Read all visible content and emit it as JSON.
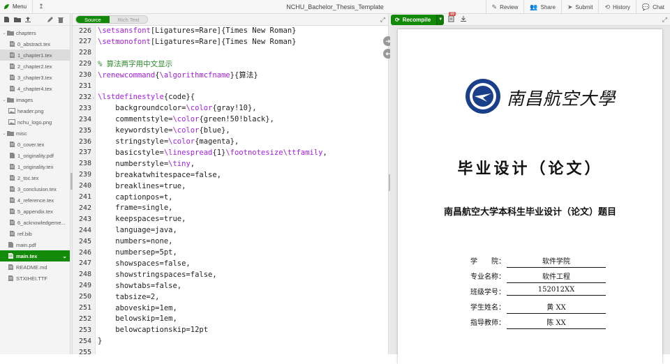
{
  "topbar": {
    "menu_label": "Menu",
    "project_title": "NCHU_Bachelor_Thesis_Template",
    "buttons": [
      {
        "label": "Review",
        "icon": "review-icon"
      },
      {
        "label": "Share",
        "icon": "share-icon"
      },
      {
        "label": "Submit",
        "icon": "submit-icon"
      },
      {
        "label": "History",
        "icon": "history-icon"
      },
      {
        "label": "Chat",
        "icon": "chat-icon"
      }
    ]
  },
  "filetree": {
    "items": [
      {
        "label": "chapters",
        "type": "folder",
        "expanded": true,
        "indent": 0
      },
      {
        "label": "0_abstract.tex",
        "type": "tex",
        "indent": 1
      },
      {
        "label": "1_chapter1.tex",
        "type": "tex",
        "indent": 1,
        "selected": true
      },
      {
        "label": "2_chapter2.tex",
        "type": "tex",
        "indent": 1
      },
      {
        "label": "3_chapter3.tex",
        "type": "tex",
        "indent": 1
      },
      {
        "label": "4_chapter4.tex",
        "type": "tex",
        "indent": 1
      },
      {
        "label": "images",
        "type": "folder",
        "expanded": true,
        "indent": 0
      },
      {
        "label": "header.png",
        "type": "image",
        "indent": 1
      },
      {
        "label": "nchu_logo.png",
        "type": "image",
        "indent": 1
      },
      {
        "label": "misc",
        "type": "folder",
        "expanded": true,
        "indent": 0
      },
      {
        "label": "0_cover.tex",
        "type": "tex",
        "indent": 1
      },
      {
        "label": "1_originality.pdf",
        "type": "pdf",
        "indent": 1
      },
      {
        "label": "1_originality.tex",
        "type": "tex",
        "indent": 1
      },
      {
        "label": "2_toc.tex",
        "type": "tex",
        "indent": 1
      },
      {
        "label": "3_conclusion.tex",
        "type": "tex",
        "indent": 1
      },
      {
        "label": "4_reference.tex",
        "type": "tex",
        "indent": 1
      },
      {
        "label": "5_appendix.tex",
        "type": "tex",
        "indent": 1
      },
      {
        "label": "6_acknowledgeme...",
        "type": "tex",
        "indent": 1
      },
      {
        "label": "ref.bib",
        "type": "bib",
        "indent": 1
      },
      {
        "label": "main.pdf",
        "type": "pdf",
        "indent": 0
      },
      {
        "label": "main.tex",
        "type": "tex",
        "indent": 0,
        "active": true
      },
      {
        "label": "README.md",
        "type": "tex",
        "indent": 0
      },
      {
        "label": "STXIHEI.TTF",
        "type": "file",
        "indent": 0
      }
    ]
  },
  "editor": {
    "toggle_source": "Source",
    "toggle_rich": "Rich Text",
    "lines": [
      {
        "n": "226",
        "text": "\\setsansfont[Ligatures=Rare]{Times New Roman}"
      },
      {
        "n": "227",
        "text": "\\setmonofont[Ligatures=Rare]{Times New Roman}"
      },
      {
        "n": "228",
        "text": ""
      },
      {
        "n": "229",
        "text": "% 算法两字用中文显示"
      },
      {
        "n": "230",
        "text": "\\renewcommand{\\algorithmcfname}{算法}"
      },
      {
        "n": "231",
        "text": ""
      },
      {
        "n": "232",
        "text": "\\lstdefinestyle{code}{",
        "fold": true
      },
      {
        "n": "233",
        "text": "    backgroundcolor=\\color{gray!10},"
      },
      {
        "n": "234",
        "text": "    commentstyle=\\color{green!50!black},"
      },
      {
        "n": "235",
        "text": "    keywordstyle=\\color{blue},"
      },
      {
        "n": "236",
        "text": "    stringstyle=\\color{magenta},"
      },
      {
        "n": "237",
        "text": "    basicstyle=\\linespread{1}\\footnotesize\\ttfamily,"
      },
      {
        "n": "238",
        "text": "    numberstyle=\\tiny,"
      },
      {
        "n": "239",
        "text": "    breakatwhitespace=false,"
      },
      {
        "n": "240",
        "text": "    breaklines=true,"
      },
      {
        "n": "241",
        "text": "    captionpos=t,"
      },
      {
        "n": "242",
        "text": "    frame=single,"
      },
      {
        "n": "243",
        "text": "    keepspaces=true,"
      },
      {
        "n": "244",
        "text": "    language=java,"
      },
      {
        "n": "245",
        "text": "    numbers=none,"
      },
      {
        "n": "246",
        "text": "    numbersep=5pt,"
      },
      {
        "n": "247",
        "text": "    showspaces=false,"
      },
      {
        "n": "248",
        "text": "    showstringspaces=false,"
      },
      {
        "n": "249",
        "text": "    showtabs=false,"
      },
      {
        "n": "250",
        "text": "    tabsize=2,"
      },
      {
        "n": "251",
        "text": "    aboveskip=1em,"
      },
      {
        "n": "252",
        "text": "    belowskip=1em,"
      },
      {
        "n": "253",
        "text": "    belowcaptionskip=12pt"
      },
      {
        "n": "254",
        "text": "}"
      },
      {
        "n": "255",
        "text": ""
      }
    ]
  },
  "pdf_toolbar": {
    "recompile_label": "Recompile",
    "log_badge": "10"
  },
  "pdf_page": {
    "university_name": "南昌航空大學",
    "title": "毕业设计（论文）",
    "topic": "南昌航空大学本科生毕业设计（论文）题目",
    "info": [
      {
        "label": "学　　院：",
        "value": "软件学院"
      },
      {
        "label": "专业名称：",
        "value": "软件工程"
      },
      {
        "label": "班级学号：",
        "value": "152012XX"
      },
      {
        "label": "学生姓名：",
        "value": "黄 XX"
      },
      {
        "label": "指导教师：",
        "value": "陈 XX"
      }
    ]
  },
  "colors": {
    "accent_green": "#138a07",
    "keyword_purple": "#a31de0",
    "comment_green": "#2a8b2a",
    "badge_red": "#d9534f"
  }
}
